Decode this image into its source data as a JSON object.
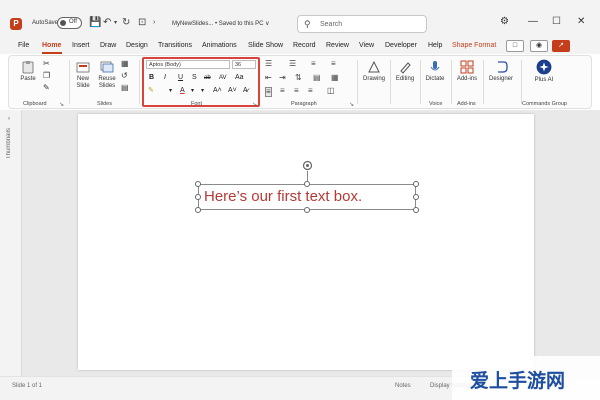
{
  "titlebar": {
    "autosave_label": "AutoSave",
    "toggle_state": "Off",
    "filename": "MyNewSlides... • Saved to this PC ∨",
    "search_placeholder": "Search"
  },
  "menu_tabs": [
    "File",
    "Home",
    "Insert",
    "Draw",
    "Design",
    "Transitions",
    "Animations",
    "Slide Show",
    "Record",
    "Review",
    "View",
    "Developer",
    "Help",
    "Shape Format"
  ],
  "active_tab": "Home",
  "ribbon": {
    "clipboard": {
      "paste_label": "Paste",
      "group_label": "Clipboard"
    },
    "slides": {
      "new_slide_label": "New Slide",
      "reuse_slides_label": "Reuse Slides",
      "group_label": "Slides"
    },
    "font": {
      "font_name": "Aptos (Body)",
      "font_size": "36",
      "group_label": "Font",
      "bold": "B",
      "italic": "I",
      "underline": "U",
      "shadow": "S",
      "strike": "ab",
      "grow": "A˄",
      "shrink": "A˅",
      "clear": "A̷"
    },
    "paragraph": {
      "group_label": "Paragraph"
    },
    "drawing": {
      "label": "Drawing"
    },
    "editing": {
      "label": "Editing"
    },
    "voice": {
      "dictate_label": "Dictate",
      "group_label": "Voice"
    },
    "addins": {
      "label": "Add-ins",
      "group_label": "Add-ins"
    },
    "designer": {
      "label": "Designer"
    },
    "commands": {
      "plus_ai_label": "Plus AI",
      "group_label": "Commands Group"
    }
  },
  "thumbnails_label": "Thumbnails",
  "slide": {
    "text": "Here’s our first text box."
  },
  "statusbar": {
    "slide_count": "Slide 1 of 1",
    "notes": "Notes",
    "display_settings": "Display Settings"
  },
  "watermark": "爱上手游网",
  "colors": {
    "accent": "#c43e1c",
    "font_highlight": "#d9443a",
    "text_red": "#b53a36",
    "plus_ai": "#1c3f8a"
  }
}
